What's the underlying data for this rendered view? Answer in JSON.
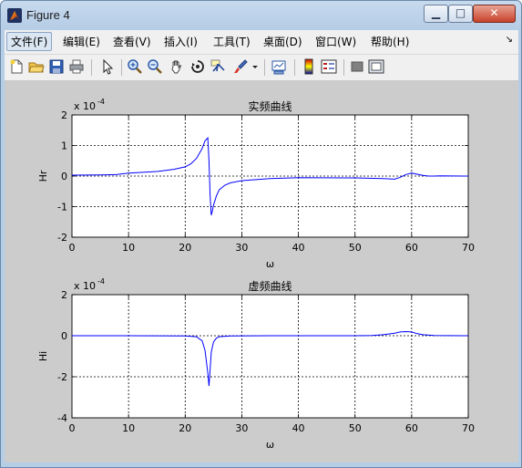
{
  "window": {
    "title": "Figure 4",
    "controls": {
      "minimize": "▁",
      "maximize": "□",
      "close": "✕"
    }
  },
  "menu": {
    "items": [
      "文件(F)",
      "编辑(E)",
      "查看(V)",
      "插入(I)",
      "工具(T)",
      "桌面(D)",
      "窗口(W)",
      "帮助(H)"
    ],
    "overflow": "↘"
  },
  "toolbar": {
    "icons": [
      "new-figure-icon",
      "open-file-icon",
      "save-icon",
      "print-icon",
      "pointer-icon",
      "zoom-in-icon",
      "zoom-out-icon",
      "pan-hand-icon",
      "rotate-3d-icon",
      "data-cursor-icon",
      "brush-icon",
      "dropdown-arrow-icon",
      "link-plot-icon",
      "colorbar-icon",
      "legend-icon",
      "hide-plot-tools-icon",
      "show-plot-tools-icon"
    ]
  },
  "chart_data": [
    {
      "type": "line",
      "title": "实频曲线",
      "xlabel": "ω",
      "ylabel": "Hr",
      "exponent_label": "x 10",
      "exponent_power": "-4",
      "xlim": [
        0,
        70
      ],
      "ylim": [
        -2,
        2
      ],
      "xticks": [
        "0",
        "10",
        "20",
        "30",
        "40",
        "50",
        "60",
        "70"
      ],
      "yticks": [
        "-2",
        "-1",
        "0",
        "1",
        "2"
      ],
      "grid": true,
      "series": [
        {
          "color": "#0000ff",
          "x": [
            0,
            5,
            8,
            10,
            15,
            18,
            20,
            21,
            22,
            23,
            23.5,
            24,
            24.2,
            24.4,
            24.6,
            24.8,
            25,
            25.5,
            26,
            27,
            28,
            30,
            35,
            40,
            50,
            55,
            57,
            58,
            59,
            60,
            61,
            62,
            63,
            64,
            65,
            70
          ],
          "y": [
            0.03,
            0.04,
            0.05,
            0.1,
            0.15,
            0.22,
            0.3,
            0.4,
            0.58,
            0.9,
            1.15,
            1.25,
            0.5,
            -0.6,
            -1.28,
            -1.15,
            -0.95,
            -0.65,
            -0.45,
            -0.3,
            -0.22,
            -0.15,
            -0.08,
            -0.05,
            -0.06,
            -0.08,
            -0.1,
            -0.04,
            0.05,
            0.1,
            0.06,
            0.02,
            0.0,
            0.0,
            0.01,
            0.0
          ]
        }
      ]
    },
    {
      "type": "line",
      "title": "虚频曲线",
      "xlabel": "ω",
      "ylabel": "Hi",
      "exponent_label": "x 10",
      "exponent_power": "-4",
      "xlim": [
        0,
        70
      ],
      "ylim": [
        -4,
        2
      ],
      "xticks": [
        "0",
        "10",
        "20",
        "30",
        "40",
        "50",
        "60",
        "70"
      ],
      "yticks": [
        "-4",
        "-2",
        "0",
        "2"
      ],
      "grid": true,
      "series": [
        {
          "color": "#0000ff",
          "x": [
            0,
            10,
            20,
            22,
            23,
            23.5,
            24,
            24.2,
            24.4,
            24.6,
            25,
            25.5,
            26,
            28,
            35,
            50,
            53,
            55,
            57,
            58,
            59,
            60,
            61,
            62,
            64,
            70
          ],
          "y": [
            0,
            0,
            -0.01,
            -0.05,
            -0.25,
            -0.7,
            -1.8,
            -2.45,
            -1.7,
            -0.8,
            -0.3,
            -0.12,
            -0.05,
            -0.01,
            0,
            0,
            0.01,
            0.05,
            0.12,
            0.18,
            0.2,
            0.18,
            0.1,
            0.05,
            0.01,
            0
          ]
        }
      ]
    }
  ]
}
